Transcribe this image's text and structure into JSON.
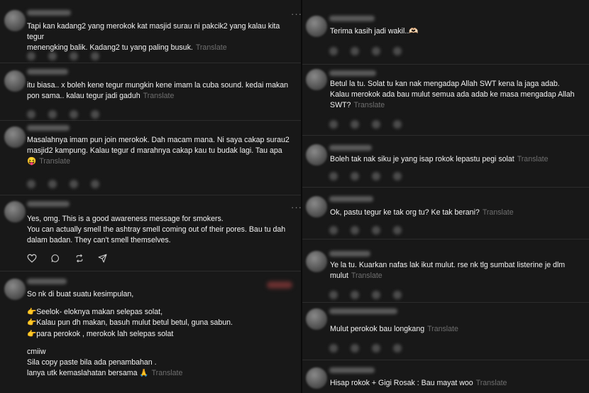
{
  "translate_label": "Translate",
  "more_label": "···",
  "left_posts": [
    {
      "lines": [
        "Tapi kan kadang2 yang merokok kat masjid surau ni pakcik2 yang kalau kita tegur",
        "menengking balik. Kadang2 tu yang paling busuk."
      ]
    },
    {
      "lines": [
        "itu biasa.. x boleh kene tegur mungkin kene imam la cuba sound. kedai makan",
        "pon sama.. kalau tegur jadi gaduh"
      ]
    },
    {
      "lines": [
        "Masalahnya imam pun join merokok. Dah macam mana. Ni saya cakap surau2",
        "masjid2 kampung. Kalau tegur d marahnya cakap kau tu budak lagi. Tau apa",
        "😝"
      ]
    },
    {
      "lines": [
        "Yes, omg. This is a good awareness message for smokers.",
        "You can actually smell the ashtray smell coming out of their pores. Bau tu dah",
        "dalam badan. They can't smell themselves."
      ]
    },
    {
      "lines": [
        "So nk di buat suatu kesimpulan,",
        "👉Seelok- eloknya makan selepas solat,",
        "👉Kalau pun dh makan, basuh mulut betul betul, guna sabun.",
        "👉para perokok , merokok lah selepas solat",
        "cmiiw",
        "Sila copy paste bila ada penambahan .",
        "lanya utk kemaslahatan bersama 🙏"
      ]
    }
  ],
  "right_posts": [
    {
      "lines": [
        "Terima kasih jadi wakil..🫶🏻"
      ]
    },
    {
      "lines": [
        "Betul la tu. Solat tu kan nak mengadap Allah SWT kena la jaga adab.",
        "Kalau merokok ada bau mulut semua ada adab ke masa mengadap Allah",
        "SWT?"
      ]
    },
    {
      "lines": [
        "Boleh tak nak siku je yang isap rokok lepastu pegi solat"
      ]
    },
    {
      "lines": [
        "Ok, pastu tegur ke tak org tu? Ke tak berani?"
      ]
    },
    {
      "lines": [
        "Ye la tu. Kuarkan nafas lak ikut mulut. rse nk tlg sumbat listerine je dlm",
        "mulut"
      ]
    },
    {
      "lines": [
        "Mulut perokok bau longkang"
      ]
    },
    {
      "lines": [
        "Hisap rokok + Gigi Rosak : Bau mayat woo"
      ]
    }
  ]
}
